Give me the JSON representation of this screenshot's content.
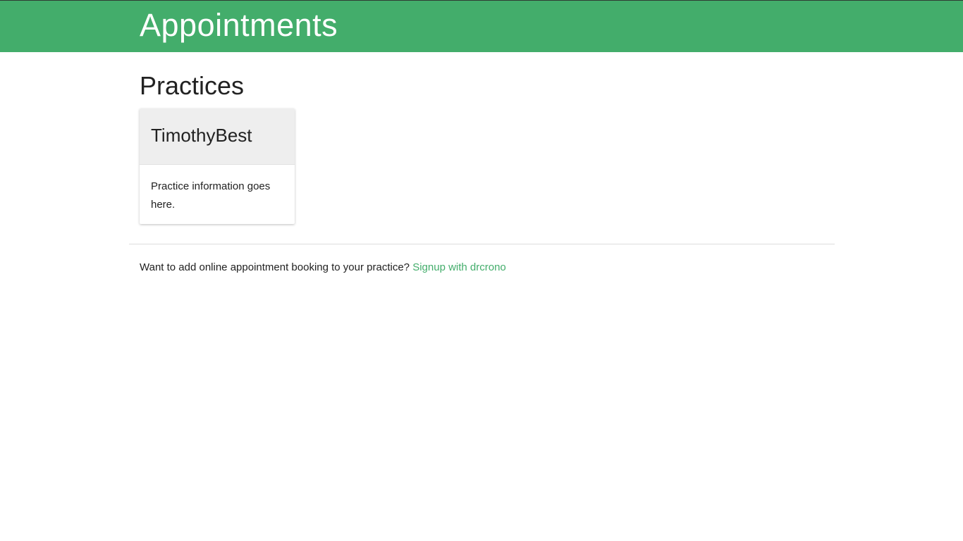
{
  "header": {
    "title": "Appointments"
  },
  "main": {
    "section_title": "Practices",
    "practices": [
      {
        "name": "TimothyBest",
        "description": "Practice information goes here."
      }
    ]
  },
  "footer": {
    "prompt_text": "Want to add online appointment booking to your practice?",
    "signup_link_label": "Signup with drcrono"
  },
  "colors": {
    "brand_green": "#43ad6b",
    "card_header_bg": "#eeeeee"
  }
}
